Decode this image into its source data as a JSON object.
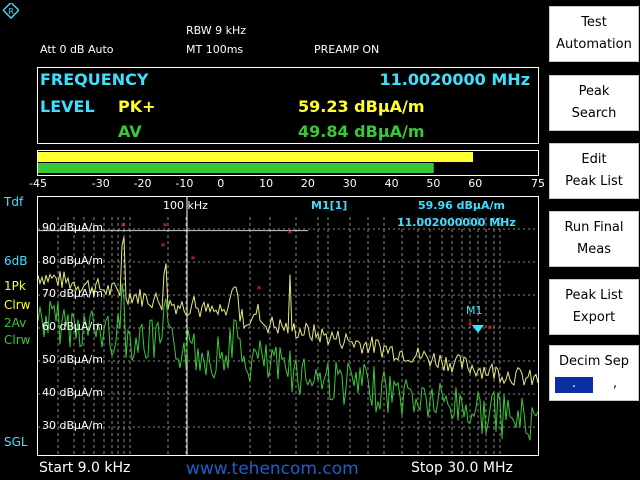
{
  "header": {
    "rbw": "RBW 9 kHz",
    "mt": "MT   100ms",
    "att": "Att  0 dB Auto",
    "preamp": "PREAMP ON"
  },
  "info": {
    "frequency_label": "FREQUENCY",
    "frequency_value": "11.0020000 MHz",
    "level_label": "LEVEL",
    "pk_label": "PK+",
    "pk_value": "59.23 dBµA/m",
    "av_label": "AV",
    "av_value": "49.84 dBµA/m"
  },
  "bargraph": {
    "scale": [
      "-45",
      "-30",
      "-20",
      "-10",
      "0",
      "10",
      "20",
      "30",
      "40",
      "50",
      "60",
      "75"
    ],
    "scale_values": [
      -45,
      -30,
      -20,
      -10,
      0,
      10,
      20,
      30,
      40,
      50,
      60,
      75
    ],
    "pk_level": 59.23,
    "av_level": 49.84,
    "range": [
      -45,
      75
    ]
  },
  "left_labels": {
    "tdf": "Tdf",
    "sixdb": "6dB",
    "trace1": "1Pk",
    "trace1_mode": "Clrw",
    "trace2": "2Av",
    "trace2_mode": "Clrw",
    "sgl": "SGL"
  },
  "plot": {
    "y_labels": [
      "90 dBµA/m",
      "80 dBµA/m",
      "70 dBµA/m",
      "60 dBµA/m",
      "50 dBµA/m",
      "40 dBµA/m",
      "30 dBµA/m"
    ],
    "marker_label_100k": "100 kHz",
    "marker_id": "M1[1]",
    "marker_level": "59.96 dBµA/m",
    "marker_freq": "11.002000000 MHz",
    "marker_tag": "M1"
  },
  "footer": {
    "start": "Start 9.0 kHz",
    "stop": "Stop 30.0 MHz",
    "watermark": "www.tehencom.com"
  },
  "softkeys": {
    "k1_l1": "Test",
    "k1_l2": "Automation",
    "k2_l1": "Peak",
    "k2_l2": "Search",
    "k3_l1": "Edit",
    "k3_l2": "Peak List",
    "k4_l1": "Run Final",
    "k4_l2": "Meas",
    "k5_l1": "Peak List",
    "k5_l2": "Export",
    "k6_l1": "Decim Sep",
    "k6_opt1": ".",
    "k6_opt2": ","
  },
  "colors": {
    "cyan": "#3fe0ff",
    "yellow": "#ffff30",
    "green": "#38c838",
    "selected": "#0a2fa0"
  }
}
